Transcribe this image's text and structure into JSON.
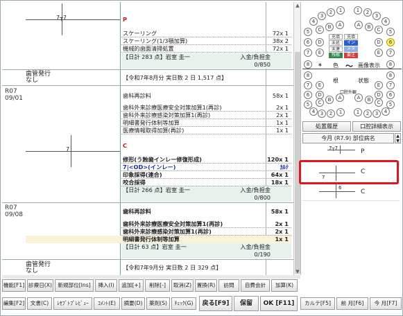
{
  "ledger": {
    "block1": {
      "tooth_label": "7┬7",
      "code": "P",
      "lines": [
        {
          "text": "スケーリング",
          "amount": "72x 1"
        },
        {
          "text": "スケーリング(1/3顎加算)",
          "amount": "38x 2"
        },
        {
          "text": "機械的歯面清掃処置",
          "amount": "72x 1"
        }
      ],
      "summary": "【日計 283 点】岩室 圭一",
      "pay_label": "入金/負担金",
      "pay_value": "0/850"
    },
    "receipt1": {
      "label": "歯管発行",
      "value": "なし",
      "text": "【令和7年8月分 実日数 2 日 1,517 点】"
    },
    "visit1": {
      "date": "R07\n09/01",
      "title": "歯科再診料",
      "title_amount": "58x 1",
      "lines": [
        {
          "text": "歯科外来診療医療安全対策加算1(再診)",
          "amount": "2x 1"
        },
        {
          "text": "歯科外来診療感染対策加算1(再診)",
          "amount": "2x 1"
        },
        {
          "text": "明細書発行体制等加算",
          "amount": "1x 1"
        },
        {
          "text": "医療情報取得加算(再診)",
          "amount": "1x 1"
        }
      ]
    },
    "block2": {
      "tooth_label": "7",
      "code": "C",
      "lines": [
        {
          "text": "修形(う蝕歯インレー修復形成)",
          "amount": "120x 1"
        },
        {
          "text": "7|<OD>(インレー)",
          "amount": "ｶﾙﾃ"
        },
        {
          "text": "印象採得(連合)",
          "amount": "64x 1"
        },
        {
          "text": "咬合採得",
          "amount": "18x 1"
        }
      ],
      "summary": "【日計 266 点】岩室 圭一",
      "pay_label": "入金/負担金",
      "pay_value": "0/800"
    },
    "visit2": {
      "date": "R07\n09/08",
      "title": "歯科再診料",
      "title_amount": "58x 1",
      "lines": [
        {
          "text": "歯科外来診療医療安全対策加算1(再診)",
          "amount": "2x 1"
        },
        {
          "text": "歯科外来診療感染対策加算1(再診)",
          "amount": "2x 1"
        },
        {
          "text": "明細書発行体制等加算",
          "amount": "1x 1"
        }
      ],
      "summary": "【日計 63 点】岩室 圭一",
      "pay_label": "入金/負担金",
      "pay_value": "0/190"
    },
    "receipt2": {
      "label": "歯管発行",
      "value": "なし",
      "text": "【令和7年9月分 実日数 2 日 329 点】"
    }
  },
  "chart": {
    "top_row": [
      "4",
      "3",
      "2",
      "1",
      "1",
      "2",
      "3",
      "4"
    ],
    "row2_left": [
      "5",
      "C",
      "B",
      "A"
    ],
    "row2_right": [
      "A",
      "B",
      "C",
      "5"
    ],
    "row3_left": [
      "6",
      "D"
    ],
    "row3_right": [
      "D",
      "6"
    ],
    "row4_left": [
      "7",
      "E"
    ],
    "row4_right": [
      "E",
      "7"
    ],
    "row5_left": "8",
    "row5_right": "8",
    "grid_top": [
      "充填",
      "充填",
      "未処",
      "イン",
      "未連",
      "メタ",
      "残根",
      "要注"
    ],
    "mid_left": "∗",
    "mid_label1": "色",
    "mid_label2": "～",
    "mid_label3": "画像表示",
    "low_left": [
      "8",
      "7",
      "6",
      "5"
    ],
    "low_right": [
      "8",
      "7",
      "6",
      "5"
    ],
    "low_mid": [
      "根",
      "状態",
      "口腔外観"
    ],
    "low_lower_left": [
      "E",
      "D",
      "C",
      "B",
      "A"
    ],
    "low_lower_right": [
      "A",
      "B",
      "C",
      "D",
      "E"
    ],
    "bottom_row": [
      "4",
      "3",
      "2",
      "1",
      "1",
      "2",
      "3",
      "4"
    ]
  },
  "right_panel": {
    "tab1": "処置履歴",
    "tab2": "口腔詳細表示",
    "period": "今月 (R7.9) 部位病名",
    "items": [
      {
        "tooth": "7┬7",
        "code": "P"
      },
      {
        "tooth": "7",
        "code": "C"
      },
      {
        "tooth": "6",
        "code": "C"
      }
    ]
  },
  "buttons_row1": [
    "機能[F1]",
    "診療日(X)",
    "新規部位[Ins]",
    "挿入(I)",
    "追加[+]",
    "削除[-]",
    "取消(Z)",
    "置換(R)",
    "訪問",
    "自費会計",
    "加算(K)"
  ],
  "buttons_row2": [
    "編集[F2]",
    "文書(C)",
    "ﾚｾﾌﾟﾄﾌﾟﾚﾋﾞｭｰ",
    "ｺﾒﾝﾄ(E)",
    "摘要(D)",
    "薬剤(S)",
    "ﾁｪｯｸ(G)",
    "戻る[F9]",
    "保留",
    "OK [F11]",
    "カルテ[F5]",
    "前 月[F6]",
    "今 月[F7]"
  ]
}
